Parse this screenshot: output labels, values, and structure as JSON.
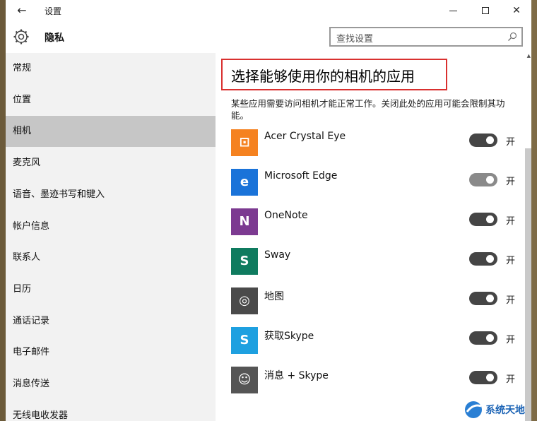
{
  "window": {
    "title": "设置",
    "back_icon": "arrow-left-icon",
    "minimize_icon": "minimize-icon",
    "maximize_icon": "maximize-icon",
    "close_icon": "close-icon"
  },
  "header": {
    "page_title": "隐私",
    "search_placeholder": "查找设置"
  },
  "sidebar": {
    "items": [
      "常规",
      "位置",
      "相机",
      "麦克风",
      "语音、墨迹书写和键入",
      "帐户信息",
      "联系人",
      "日历",
      "通话记录",
      "电子邮件",
      "消息传送",
      "无线电收发器"
    ],
    "active_index": 2
  },
  "main": {
    "heading": "选择能够使用你的相机的应用",
    "description": "某些应用需要访问相机才能正常工作。关闭此处的应用可能会限制其功能。",
    "apps": [
      {
        "name": "Acer Crystal Eye",
        "toggle": "开",
        "color": "#f58220",
        "glyph": "⊡",
        "dim": false
      },
      {
        "name": "Microsoft Edge",
        "toggle": "开",
        "color": "#1a73d9",
        "glyph": "e",
        "dim": true
      },
      {
        "name": "OneNote",
        "toggle": "开",
        "color": "#7c3a91",
        "glyph": "N",
        "dim": false
      },
      {
        "name": "Sway",
        "toggle": "开",
        "color": "#0f7b5f",
        "glyph": "S",
        "dim": false
      },
      {
        "name": "地图",
        "toggle": "开",
        "color": "#4a4a4a",
        "glyph": "◎",
        "dim": false
      },
      {
        "name": "获取Skype",
        "toggle": "开",
        "color": "#1ea0e0",
        "glyph": "S",
        "dim": false
      },
      {
        "name": "消息 + Skype",
        "toggle": "开",
        "color": "#555555",
        "glyph": "☺",
        "dim": false
      }
    ]
  },
  "watermark": {
    "text": "系统天地"
  }
}
